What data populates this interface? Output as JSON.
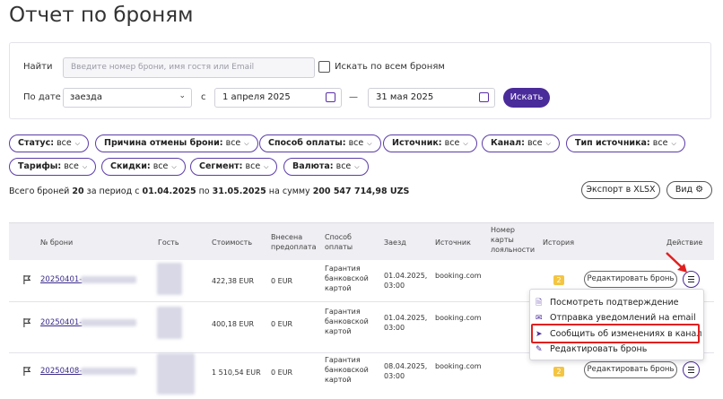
{
  "page": {
    "title": "Отчет по броням"
  },
  "filters": {
    "search_label": "Найти",
    "search_placeholder": "Введите номер брони, имя гостя или Email",
    "search_all_label": "Искать по всем броням",
    "date_label": "По дате",
    "date_type": "заезда",
    "from_prefix": "с",
    "date_from": "1 апреля 2025",
    "dash": "—",
    "date_to": "31 мая 2025",
    "search_button": "Искать"
  },
  "chips": [
    {
      "label": "Статус:",
      "value": "все"
    },
    {
      "label": "Причина отмены брони:",
      "value": "все"
    },
    {
      "label": "Способ оплаты:",
      "value": "все"
    },
    {
      "label": "Источник:",
      "value": "все"
    },
    {
      "label": "Канал:",
      "value": "все"
    },
    {
      "label": "Тип источника:",
      "value": "все"
    },
    {
      "label": "Тарифы:",
      "value": "все"
    },
    {
      "label": "Скидки:",
      "value": "все"
    },
    {
      "label": "Сегмент:",
      "value": "все"
    },
    {
      "label": "Валюта:",
      "value": "все"
    }
  ],
  "summary": {
    "prefix": "Всего броней",
    "count": "20",
    "period_text": "за период с",
    "from": "01.04.2025",
    "to_text": "по",
    "to": "31.05.2025",
    "sum_text": "на сумму",
    "total": "200 547 714,98 UZS"
  },
  "toolbar": {
    "export_label": "Экспорт в XLSX",
    "view_label": "Вид"
  },
  "table": {
    "headers": {
      "number": "№ брони",
      "guest": "Гость",
      "cost": "Стоимость",
      "prepay": [
        "Внесена",
        "предоплата"
      ],
      "payment": [
        "Способ",
        "оплаты"
      ],
      "checkin": "Заезд",
      "source": "Источник",
      "card": [
        "Номер",
        "карты",
        "лояльности"
      ],
      "history": "История",
      "action": "Действие"
    },
    "rows": [
      {
        "id": "20250401-",
        "cost": "422,38 EUR",
        "prepay": "0 EUR",
        "payment": [
          "Гарантия",
          "банковской",
          "картой"
        ],
        "checkin": [
          "01.04.2025,",
          "03:00"
        ],
        "source": "booking.com",
        "history": "2",
        "edit": "Редактировать бронь"
      },
      {
        "id": "20250401-",
        "cost": "400,18 EUR",
        "prepay": "0 EUR",
        "payment": [
          "Гарантия",
          "банковской",
          "картой"
        ],
        "checkin": [
          "01.04.2025,",
          "03:00"
        ],
        "source": "booking.com",
        "history": "",
        "edit": ""
      },
      {
        "id": "20250408-",
        "cost": "1 510,54 EUR",
        "prepay": "0 EUR",
        "payment": [
          "Гарантия",
          "банковской",
          "картой"
        ],
        "checkin": [
          "08.04.2025,",
          "03:00"
        ],
        "source": "booking.com",
        "history": "2",
        "edit": "Редактировать бронь"
      }
    ]
  },
  "menu": {
    "items": [
      {
        "label": "Посмотреть подтверждение",
        "icon": "document-icon"
      },
      {
        "label": "Отправка уведомлений на email",
        "icon": "mail-icon"
      },
      {
        "label": "Сообщить об изменениях в канал",
        "icon": "send-icon"
      },
      {
        "label": "Редактировать бронь",
        "icon": "pencil-icon"
      }
    ]
  },
  "colors": {
    "accent": "#4a2b9a",
    "highlight": "#e02020",
    "badge": "#f4c542"
  }
}
